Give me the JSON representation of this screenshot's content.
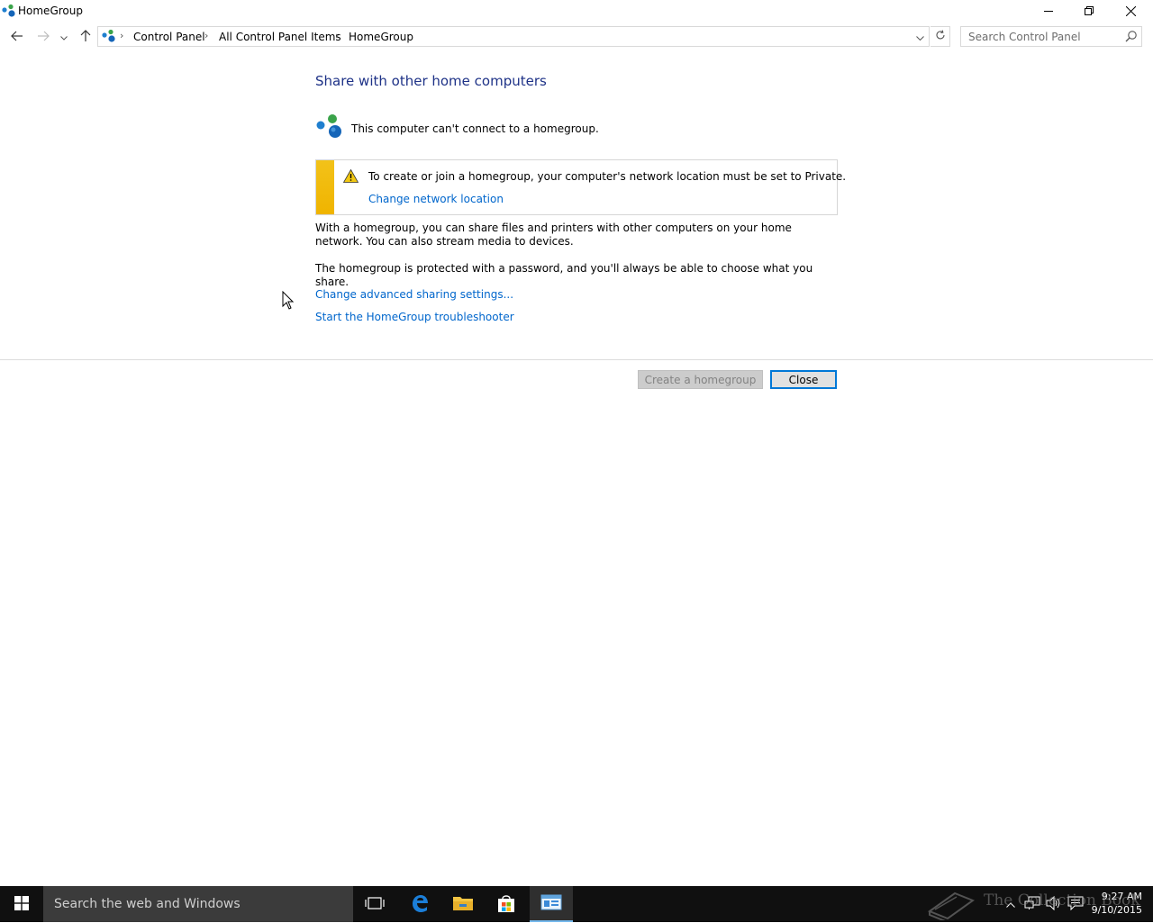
{
  "window": {
    "title": "HomeGroup",
    "minimize_icon": "minimize-icon",
    "restore_icon": "restore-icon",
    "close_icon": "close-icon"
  },
  "navigation": {
    "back_icon": "back-arrow-icon",
    "forward_icon": "forward-arrow-icon",
    "recent_icon": "chevron-down-icon",
    "up_icon": "up-arrow-icon",
    "breadcrumbs": [
      "Control Panel",
      "All Control Panel Items",
      "HomeGroup"
    ],
    "refresh_icon": "refresh-icon"
  },
  "search": {
    "placeholder": "Search Control Panel"
  },
  "main": {
    "heading": "Share with other home computers",
    "status_text": "This computer can't connect to a homegroup.",
    "warning": {
      "text": "To create or join a homegroup, your computer's network location must be set to Private.",
      "link": "Change network location"
    },
    "paragraph1": "With a homegroup, you can share files and printers with other computers on your home network. You can also stream media to devices.",
    "paragraph2": "The homegroup is protected with a password, and you'll always be able to choose what you share.",
    "links": [
      "Change advanced sharing settings...",
      "Start the HomeGroup troubleshooter"
    ]
  },
  "buttons": {
    "create": "Create a homegroup",
    "close": "Close"
  },
  "taskbar": {
    "search_placeholder": "Search the web and Windows",
    "time": "9:27 AM",
    "date": "9/10/2015"
  },
  "watermark": {
    "text": "The Collection Book"
  },
  "colors": {
    "heading": "#1e3287",
    "link": "#0066cc",
    "warning_stripe": "#f0b400",
    "taskbar": "#101010",
    "accent": "#0078d7"
  }
}
